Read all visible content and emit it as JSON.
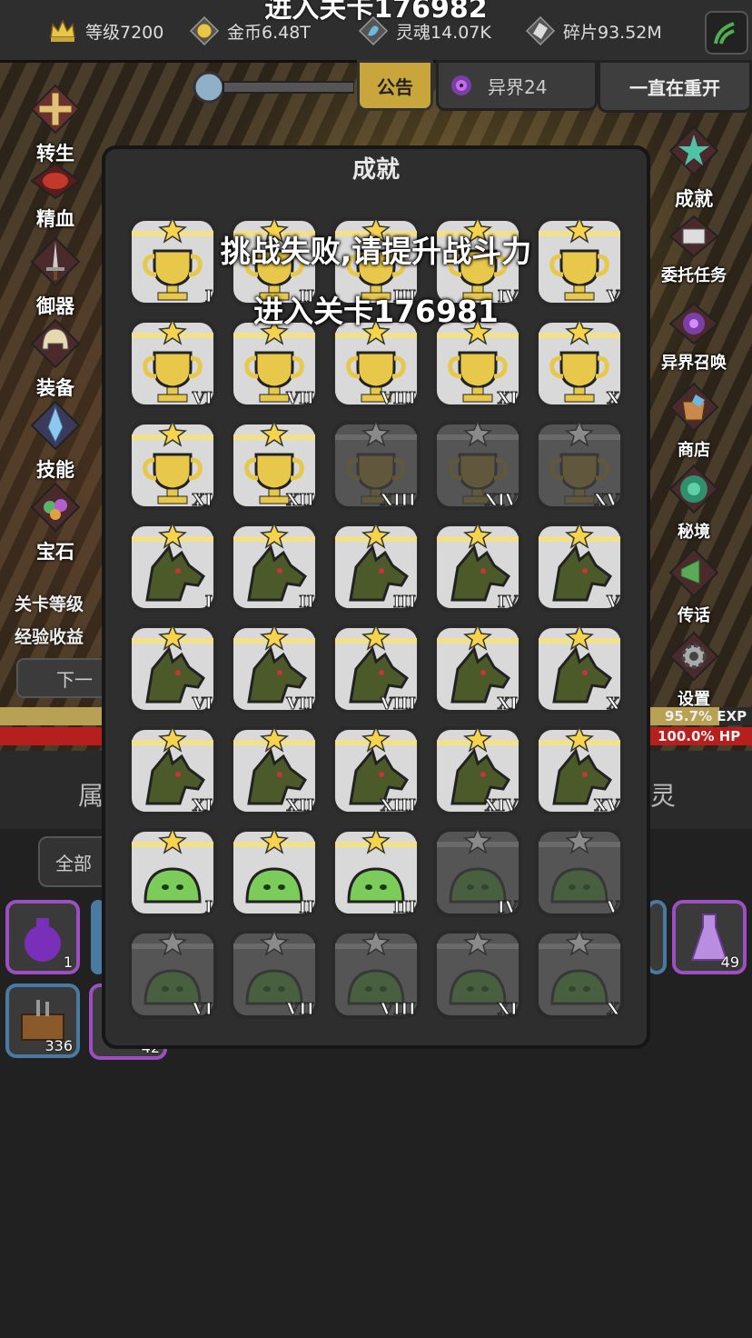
{
  "top_message": "进入关卡176982",
  "stats": {
    "level": "等级7200",
    "gold": "金币6.48T",
    "soul": "灵魂14.07K",
    "shards": "碎片93.52M"
  },
  "notice_label": "公告",
  "realm_label": "异界24",
  "restart_label": "一直在重开",
  "left_menu": [
    "转生",
    "精血",
    "御器",
    "装备",
    "技能",
    "宝石"
  ],
  "right_menu": [
    "成就",
    "委托任务",
    "异界召唤",
    "商店",
    "秘境",
    "传话",
    "设置"
  ],
  "stage_level_label": "关卡等级",
  "exp_income_label": "经验收益",
  "next_button": "下一",
  "exp_bar": {
    "text": "95.7% EXP",
    "fraction": 0.957
  },
  "hp_bar": {
    "text": "100.0% HP",
    "fraction": 1.0
  },
  "bottom_tabs": {
    "left": "属",
    "right": "灵"
  },
  "filter_label": "全部",
  "inventory": [
    {
      "name": "purple-bag",
      "count": "1"
    },
    {
      "name": "purple-flask",
      "count": "49"
    },
    {
      "name": "toolbox",
      "count": "336"
    },
    {
      "name": "hidden-item",
      "count": "42"
    }
  ],
  "modal": {
    "title": "成就",
    "rows": [
      {
        "icon": "trophy",
        "items": [
          [
            "I",
            1
          ],
          [
            "II",
            1
          ],
          [
            "III",
            1
          ],
          [
            "IV",
            1
          ],
          [
            "V",
            1
          ]
        ]
      },
      {
        "icon": "trophy",
        "items": [
          [
            "VI",
            1
          ],
          [
            "VII",
            1
          ],
          [
            "VIII",
            1
          ],
          [
            "XI",
            1
          ],
          [
            "X",
            1
          ]
        ]
      },
      {
        "icon": "trophy",
        "items": [
          [
            "XI",
            1
          ],
          [
            "XII",
            1
          ],
          [
            "XIII",
            0
          ],
          [
            "XIV",
            0
          ],
          [
            "XV",
            0
          ]
        ]
      },
      {
        "icon": "wolf",
        "items": [
          [
            "I",
            1
          ],
          [
            "II",
            1
          ],
          [
            "III",
            1
          ],
          [
            "IV",
            1
          ],
          [
            "V",
            1
          ]
        ]
      },
      {
        "icon": "wolf",
        "items": [
          [
            "VI",
            1
          ],
          [
            "VII",
            1
          ],
          [
            "VIII",
            1
          ],
          [
            "XI",
            1
          ],
          [
            "X",
            1
          ]
        ]
      },
      {
        "icon": "wolf",
        "items": [
          [
            "XI",
            1
          ],
          [
            "XII",
            1
          ],
          [
            "XIII",
            1
          ],
          [
            "XIV",
            1
          ],
          [
            "XV",
            1
          ]
        ]
      },
      {
        "icon": "slime",
        "items": [
          [
            "I",
            1
          ],
          [
            "II",
            1
          ],
          [
            "III",
            1
          ],
          [
            "IV",
            0
          ],
          [
            "V",
            0
          ]
        ]
      },
      {
        "icon": "slime",
        "items": [
          [
            "VI",
            0
          ],
          [
            "VII",
            0
          ],
          [
            "VIII",
            0
          ],
          [
            "XI",
            0
          ],
          [
            "X",
            0
          ]
        ]
      }
    ]
  },
  "toast": {
    "line1": "挑战失败,请提升战斗力",
    "line2": "进入关卡176981"
  },
  "colors": {
    "gold": "#e7c64a",
    "exp": "#b8a055",
    "hp": "#b5201e",
    "slime": "#7ccc5c",
    "wolf": "#4c5a2a"
  }
}
